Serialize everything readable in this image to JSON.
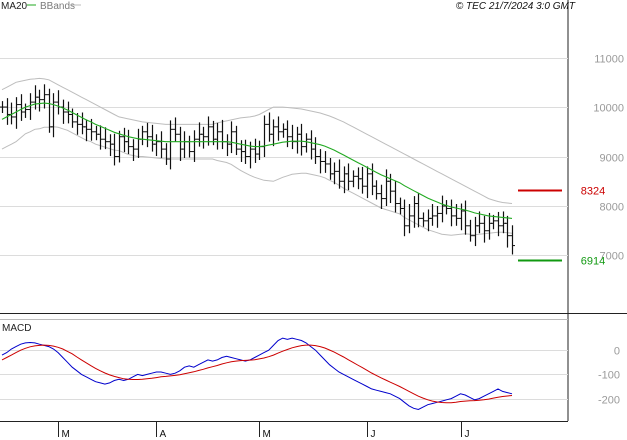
{
  "copyright": "© TEC 21/7/2024 3:0 GMT",
  "chart_data": [
    {
      "type": "line",
      "panel": "price",
      "legend": [
        {
          "label": "MA20",
          "color": "#22aa22"
        },
        {
          "label": "BBands",
          "color": "#bbbbbb"
        }
      ],
      "y_ticks": [
        {
          "value": 11000,
          "label": "11000"
        },
        {
          "value": 10000,
          "label": "10000"
        },
        {
          "value": 9000,
          "label": "9000"
        },
        {
          "value": 8000,
          "label": "8000"
        },
        {
          "value": 7000,
          "label": "7000"
        }
      ],
      "ylim": [
        6100,
        11800
      ],
      "grid": true,
      "x_months": [
        "M",
        "A",
        "M",
        "J",
        "J"
      ],
      "ohlc_close": [
        10000,
        9850,
        9800,
        10050,
        9900,
        9950,
        10100,
        10200,
        10150,
        10250,
        9600,
        10100,
        10000,
        9900,
        9850,
        9700,
        9650,
        9600,
        9550,
        9500,
        9450,
        9350,
        9300,
        9250,
        9000,
        9400,
        9300,
        9200,
        9150,
        9350,
        9500,
        9400,
        9250,
        9300,
        9150,
        8950,
        9550,
        9450,
        9150,
        9300,
        9100,
        9350,
        9450,
        9400,
        9600,
        9350,
        9500,
        9300,
        9250,
        9500,
        9150,
        9100,
        9000,
        9150,
        9050,
        9200,
        9650,
        9450,
        9600,
        9500,
        9550,
        9400,
        9300,
        9450,
        9200,
        9350,
        9150,
        9000,
        8900,
        8850,
        8650,
        8700,
        8500,
        8650,
        8500,
        8600,
        8550,
        8400,
        8650,
        8400,
        8250,
        8150,
        8500,
        8300,
        8050,
        7950,
        7600,
        7800,
        8050,
        7750,
        7700,
        7750,
        7800,
        7850,
        8000,
        7950,
        7800,
        7750,
        7900,
        7600,
        7400,
        7600,
        7650,
        7500,
        7650,
        7700,
        7600,
        7650,
        7400,
        7200
      ],
      "ma20": [
        9750,
        9800,
        9850,
        9900,
        9950,
        10000,
        10030,
        10060,
        10070,
        10080,
        10070,
        10050,
        10020,
        9980,
        9940,
        9890,
        9840,
        9790,
        9740,
        9700,
        9650,
        9610,
        9570,
        9530,
        9490,
        9460,
        9430,
        9400,
        9380,
        9360,
        9350,
        9340,
        9330,
        9320,
        9310,
        9300,
        9300,
        9300,
        9300,
        9300,
        9300,
        9300,
        9300,
        9300,
        9300,
        9300,
        9300,
        9300,
        9300,
        9290,
        9270,
        9250,
        9230,
        9210,
        9200,
        9200,
        9210,
        9230,
        9250,
        9270,
        9290,
        9300,
        9310,
        9310,
        9310,
        9300,
        9280,
        9260,
        9240,
        9210,
        9170,
        9130,
        9080,
        9030,
        8980,
        8930,
        8880,
        8830,
        8780,
        8730,
        8680,
        8630,
        8590,
        8550,
        8510,
        8470,
        8410,
        8360,
        8310,
        8260,
        8210,
        8160,
        8120,
        8080,
        8040,
        8010,
        7980,
        7960,
        7940,
        7920,
        7890,
        7860,
        7840,
        7820,
        7800,
        7790,
        7780,
        7770,
        7760,
        7750
      ],
      "bb_upper": [
        10350,
        10400,
        10450,
        10500,
        10520,
        10540,
        10560,
        10570,
        10580,
        10570,
        10550,
        10500,
        10450,
        10400,
        10350,
        10300,
        10250,
        10200,
        10150,
        10100,
        10050,
        10000,
        9950,
        9900,
        9850,
        9800,
        9780,
        9760,
        9740,
        9720,
        9700,
        9690,
        9680,
        9670,
        9660,
        9650,
        9650,
        9650,
        9650,
        9650,
        9650,
        9650,
        9650,
        9650,
        9650,
        9650,
        9680,
        9700,
        9720,
        9740,
        9760,
        9780,
        9790,
        9800,
        9820,
        9850,
        9900,
        9950,
        10000,
        10000,
        10000,
        9990,
        9980,
        9970,
        9960,
        9940,
        9920,
        9900,
        9880,
        9850,
        9820,
        9780,
        9740,
        9700,
        9650,
        9600,
        9550,
        9500,
        9450,
        9400,
        9350,
        9300,
        9250,
        9200,
        9150,
        9100,
        9050,
        9000,
        8950,
        8900,
        8850,
        8800,
        8750,
        8700,
        8650,
        8600,
        8550,
        8500,
        8450,
        8400,
        8350,
        8300,
        8250,
        8200,
        8150,
        8120,
        8090,
        8070,
        8060,
        8050
      ],
      "bb_lower": [
        9150,
        9200,
        9250,
        9300,
        9380,
        9460,
        9500,
        9550,
        9560,
        9590,
        9590,
        9600,
        9590,
        9560,
        9530,
        9480,
        9430,
        9380,
        9330,
        9300,
        9250,
        9220,
        9190,
        9160,
        9130,
        9120,
        9080,
        9040,
        9020,
        9000,
        9000,
        8990,
        8980,
        8970,
        8960,
        8950,
        8950,
        8950,
        8950,
        8950,
        8950,
        8950,
        8950,
        8950,
        8950,
        8950,
        8920,
        8900,
        8880,
        8840,
        8780,
        8720,
        8670,
        8620,
        8580,
        8550,
        8520,
        8510,
        8500,
        8540,
        8580,
        8610,
        8640,
        8650,
        8660,
        8660,
        8640,
        8620,
        8600,
        8570,
        8520,
        8480,
        8420,
        8360,
        8310,
        8260,
        8210,
        8160,
        8110,
        8060,
        8010,
        7960,
        7930,
        7900,
        7870,
        7840,
        7770,
        7720,
        7670,
        7620,
        7570,
        7520,
        7490,
        7460,
        7430,
        7420,
        7410,
        7420,
        7430,
        7440,
        7430,
        7420,
        7430,
        7440,
        7450,
        7460,
        7470,
        7470,
        7460,
        7450
      ],
      "levels": [
        {
          "label": "8324",
          "value": 8324,
          "color": "#cc0000"
        },
        {
          "label": "6914",
          "value": 6914,
          "color": "#119911"
        }
      ]
    },
    {
      "type": "line",
      "panel": "macd",
      "title": "MACD",
      "y_ticks": [
        {
          "value": 0,
          "label": "0"
        },
        {
          "value": -100,
          "label": "-100"
        },
        {
          "value": -200,
          "label": "-200"
        }
      ],
      "ylim": [
        -280,
        100
      ],
      "grid": true,
      "series": [
        {
          "color": "#0000cc",
          "values": [
            -20,
            -10,
            5,
            15,
            25,
            30,
            32,
            30,
            25,
            20,
            15,
            5,
            -10,
            -30,
            -50,
            -70,
            -85,
            -100,
            -110,
            -120,
            -130,
            -135,
            -140,
            -135,
            -125,
            -120,
            -125,
            -120,
            -110,
            -100,
            -105,
            -100,
            -95,
            -90,
            -90,
            -95,
            -100,
            -95,
            -85,
            -70,
            -65,
            -70,
            -60,
            -50,
            -40,
            -45,
            -40,
            -30,
            -25,
            -30,
            -35,
            -40,
            -45,
            -40,
            -30,
            -20,
            -10,
            0,
            20,
            40,
            50,
            45,
            50,
            45,
            40,
            30,
            15,
            0,
            -20,
            -40,
            -60,
            -75,
            -90,
            -100,
            -110,
            -120,
            -130,
            -140,
            -150,
            -160,
            -165,
            -170,
            -175,
            -180,
            -190,
            -200,
            -215,
            -230,
            -240,
            -245,
            -235,
            -225,
            -220,
            -215,
            -210,
            -205,
            -200,
            -190,
            -180,
            -185,
            -195,
            -205,
            -200,
            -190,
            -180,
            -170,
            -160,
            -170,
            -175,
            -180
          ]
        },
        {
          "color": "#cc0000",
          "values": [
            -40,
            -30,
            -20,
            -10,
            0,
            8,
            14,
            18,
            20,
            21,
            20,
            17,
            12,
            5,
            -5,
            -15,
            -28,
            -40,
            -52,
            -64,
            -75,
            -85,
            -94,
            -102,
            -108,
            -113,
            -118,
            -120,
            -121,
            -121,
            -120,
            -118,
            -116,
            -113,
            -110,
            -108,
            -106,
            -104,
            -101,
            -97,
            -93,
            -89,
            -84,
            -79,
            -73,
            -68,
            -63,
            -57,
            -52,
            -48,
            -45,
            -43,
            -42,
            -41,
            -39,
            -36,
            -32,
            -27,
            -20,
            -12,
            -4,
            3,
            10,
            15,
            19,
            21,
            21,
            19,
            15,
            9,
            1,
            -8,
            -18,
            -28,
            -39,
            -50,
            -61,
            -72,
            -83,
            -94,
            -104,
            -114,
            -123,
            -132,
            -141,
            -150,
            -160,
            -170,
            -180,
            -190,
            -198,
            -205,
            -210,
            -214,
            -216,
            -217,
            -217,
            -215,
            -212,
            -210,
            -209,
            -208,
            -207,
            -205,
            -202,
            -198,
            -194,
            -191,
            -189,
            -187
          ]
        }
      ]
    }
  ]
}
